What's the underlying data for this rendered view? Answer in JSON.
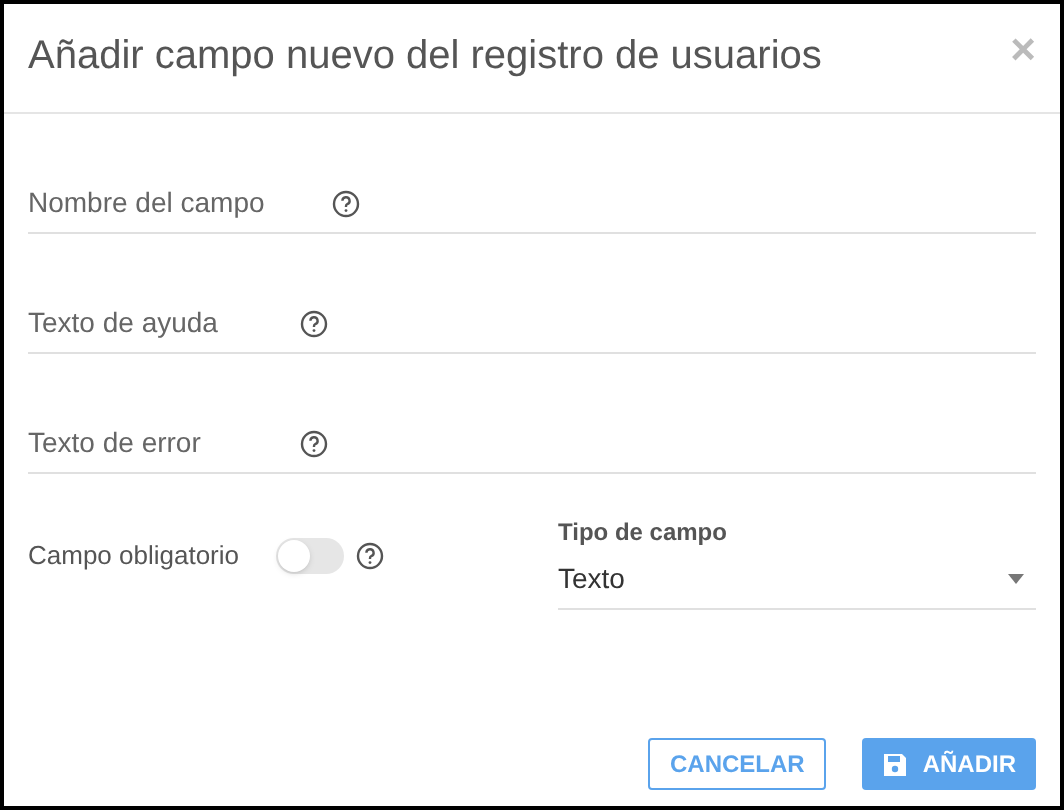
{
  "dialog": {
    "title": "Añadir campo nuevo del registro de usuarios",
    "close": "×"
  },
  "fields": [
    {
      "placeholder": "Nombre del campo"
    },
    {
      "placeholder": "Texto de ayuda"
    },
    {
      "placeholder": "Texto de error"
    }
  ],
  "required_toggle": {
    "label": "Campo obligatorio",
    "on": false
  },
  "field_type": {
    "label": "Tipo de campo",
    "value": "Texto"
  },
  "buttons": [
    {
      "label": "CANCELAR",
      "kind": "outline"
    },
    {
      "label": "AÑADIR",
      "kind": "primary"
    }
  ]
}
